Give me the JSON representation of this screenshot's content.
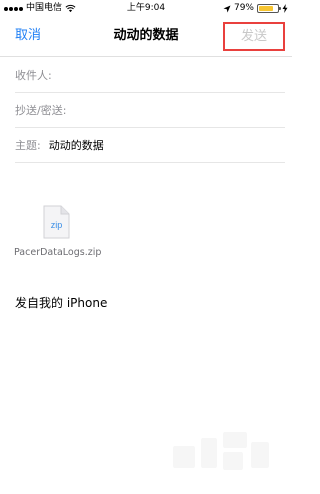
{
  "status_bar": {
    "carrier": "中国电信",
    "time": "上午9:04",
    "battery_percent": "79%",
    "battery_level": 0.79,
    "battery_color": "#f7c531"
  },
  "nav": {
    "cancel_label": "取消",
    "title": "动动的数据",
    "send_label": "发送",
    "accent_color": "#1f7ff5",
    "highlight_color": "#e9403d"
  },
  "fields": {
    "to_label": "收件人:",
    "cc_label": "抄送/密送:",
    "subject_label": "主题:",
    "subject_value": "动动的数据"
  },
  "attachment": {
    "icon_text": "zip",
    "file_name": "PacerDataLogs.zip",
    "icon": "zip-file-icon"
  },
  "body": {
    "signature": "发自我的 iPhone"
  }
}
